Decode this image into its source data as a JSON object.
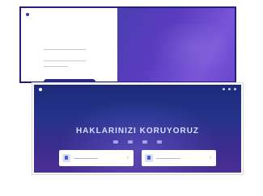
{
  "back_window": {
    "logo_text": "",
    "title": "",
    "fields": [
      "",
      ""
    ],
    "button_label": ""
  },
  "front_window": {
    "brand": "",
    "nav_items": [
      "",
      "",
      "",
      "",
      ""
    ],
    "headline": "HAKLARINIZI KORUYORUZ",
    "cta_cards": [
      {
        "title": ""
      },
      {
        "title": ""
      }
    ]
  },
  "colors": {
    "brand_dark": "#241f7a",
    "hero_purple": "#5a3cc0",
    "cta_arrow": "#e26a3b"
  }
}
